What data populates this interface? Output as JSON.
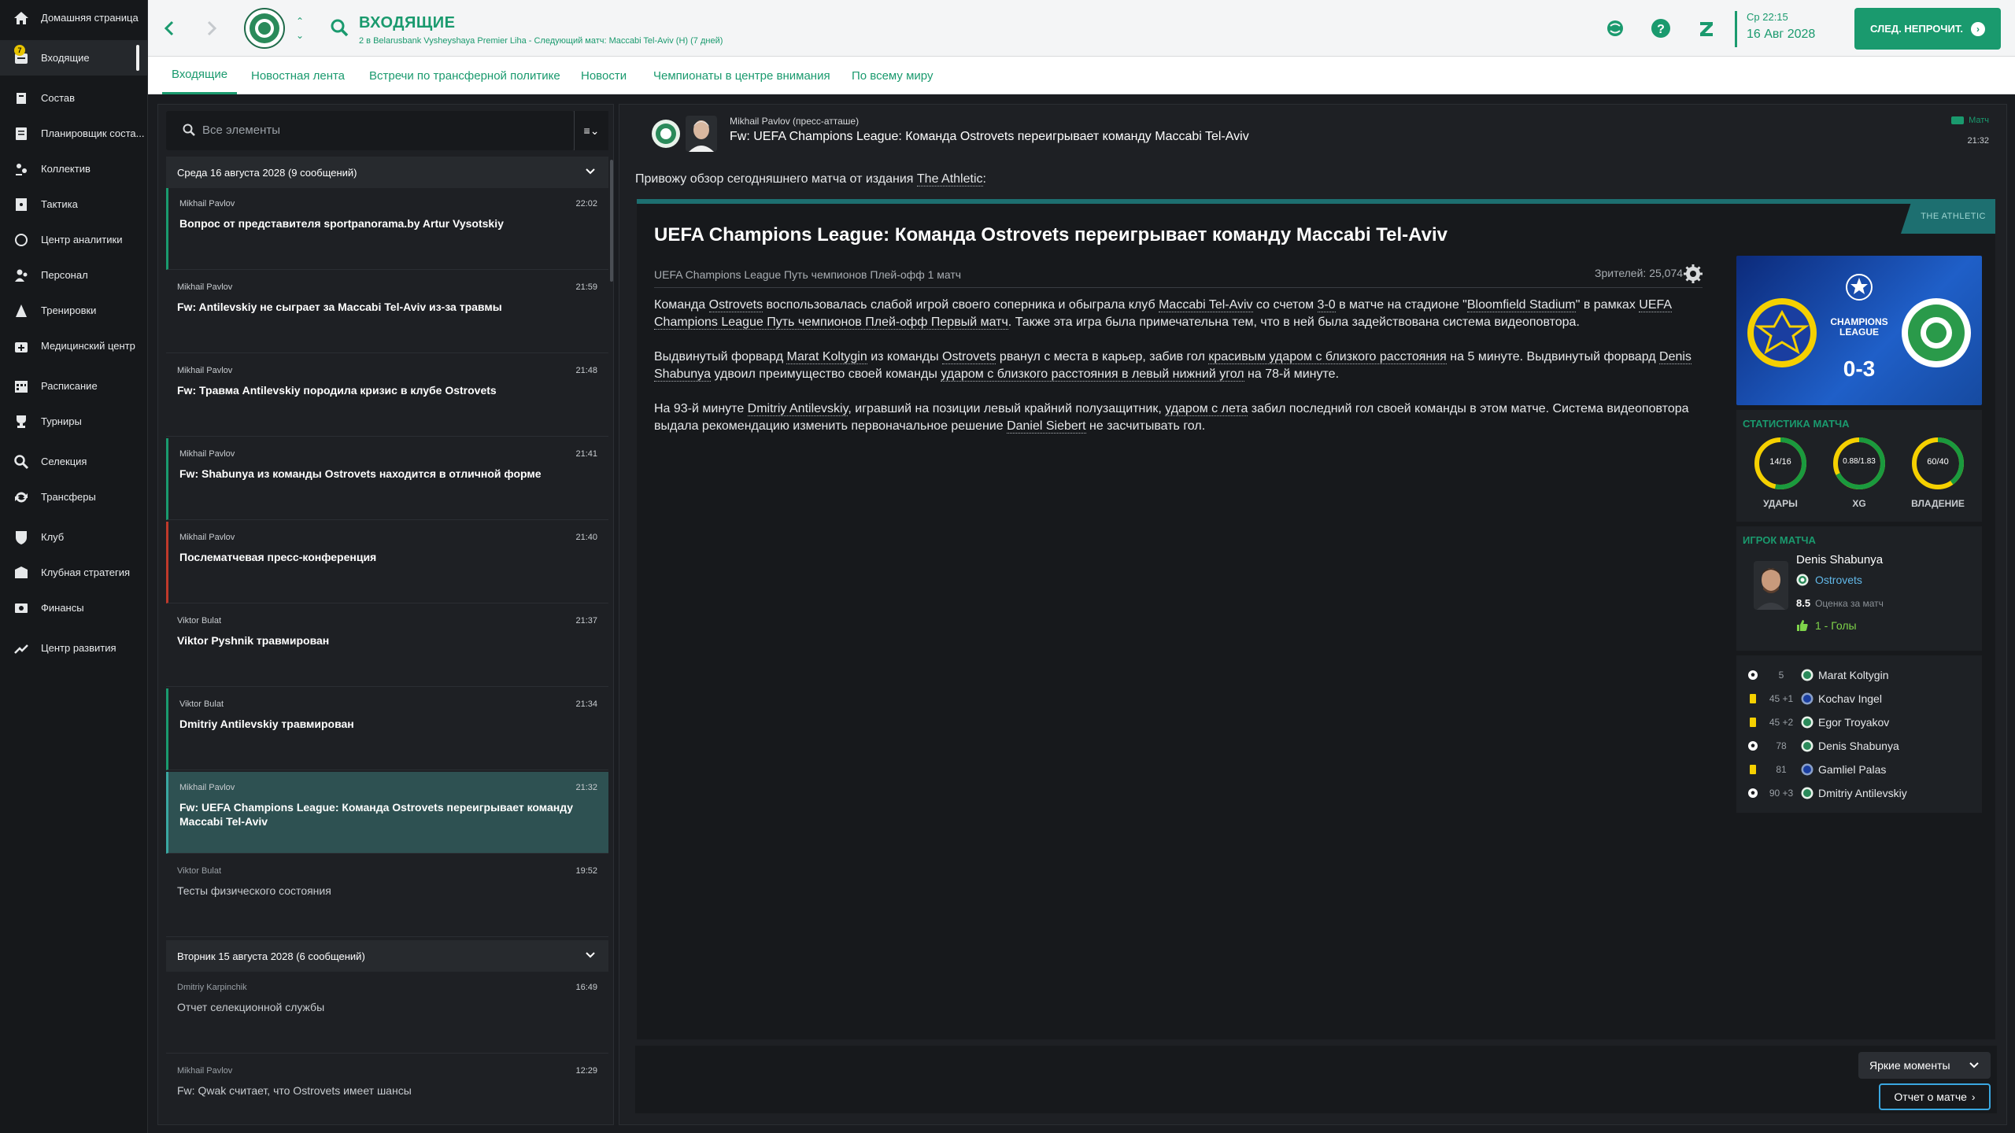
{
  "sidebar": {
    "items": [
      {
        "label": "Домашняя страница",
        "icon": "home-icon"
      },
      {
        "label": "Входящие",
        "icon": "inbox-icon",
        "badge": "7"
      },
      {
        "label": "Состав",
        "icon": "squad-icon"
      },
      {
        "label": "Планировщик соста...",
        "icon": "planner-icon"
      },
      {
        "label": "Коллектив",
        "icon": "dynamics-icon"
      },
      {
        "label": "Тактика",
        "icon": "tactics-icon"
      },
      {
        "label": "Центр аналитики",
        "icon": "analytics-icon"
      },
      {
        "label": "Персонал",
        "icon": "staff-icon"
      },
      {
        "label": "Тренировки",
        "icon": "training-icon"
      },
      {
        "label": "Медицинский центр",
        "icon": "medical-icon"
      },
      {
        "label": "Расписание",
        "icon": "calendar-icon"
      },
      {
        "label": "Турниры",
        "icon": "trophy-icon"
      },
      {
        "label": "Селекция",
        "icon": "scouting-icon"
      },
      {
        "label": "Трансферы",
        "icon": "transfers-icon"
      },
      {
        "label": "Клуб",
        "icon": "club-icon"
      },
      {
        "label": "Клубная стратегия",
        "icon": "strategy-icon"
      },
      {
        "label": "Финансы",
        "icon": "finance-icon"
      },
      {
        "label": "Центр развития",
        "icon": "development-icon"
      }
    ]
  },
  "header": {
    "title": "ВХОДЯЩИЕ",
    "subtitle": "2 в Belarusbank Vysheyshaya Premier Liha - Следующий матч: Maccabi Tel-Aviv (H) (7 дней)",
    "date_day": "Ср 22:15",
    "date_full": "16 Авг 2028",
    "next_button": "СЛЕД. НЕПРОЧИТ.",
    "accent": "#1a9a6e"
  },
  "tabs": [
    "Входящие",
    "Новостная лента",
    "Встречи по трансферной политике",
    "Новости",
    "Чемпионаты в центре внимания",
    "По всему миру"
  ],
  "inbox": {
    "search_placeholder": "Все элементы",
    "groups": [
      {
        "label": "Среда 16 августа 2028 (9 сообщений)"
      },
      {
        "label": "Вторник 15 августа 2028 (6 сообщений)"
      }
    ],
    "messages": [
      {
        "from": "Mikhail Pavlov",
        "time": "22:02",
        "subject": "Вопрос от представителя sportpanorama.by Artur Vysotskiy"
      },
      {
        "from": "Mikhail Pavlov",
        "time": "21:59",
        "subject": "Fw: Antilevskiy не сыграет за Maccabi Tel-Aviv из-за травмы"
      },
      {
        "from": "Mikhail Pavlov",
        "time": "21:48",
        "subject": "Fw: Травма Antilevskiy породила кризис в клубе Ostrovets"
      },
      {
        "from": "Mikhail Pavlov",
        "time": "21:41",
        "subject": "Fw: Shabunya из команды Ostrovets находится в отличной форме"
      },
      {
        "from": "Mikhail Pavlov",
        "time": "21:40",
        "subject": "Послематчевая пресс-конференция"
      },
      {
        "from": "Viktor Bulat",
        "time": "21:37",
        "subject": "Viktor Pyshnik травмирован"
      },
      {
        "from": "Viktor Bulat",
        "time": "21:34",
        "subject": "Dmitriy Antilevskiy травмирован"
      },
      {
        "from": "Mikhail Pavlov",
        "time": "21:32",
        "subject": "Fw: UEFA Champions League: Команда Ostrovets переигрывает команду Maccabi Tel-Aviv"
      },
      {
        "from": "Viktor Bulat",
        "time": "19:52",
        "subject": "Тесты физического состояния"
      },
      {
        "from": "Dmitriy Karpinchik",
        "time": "16:49",
        "subject": "Отчет селекционной службы"
      },
      {
        "from": "Mikhail Pavlov",
        "time": "12:29",
        "subject": "Fw: Qwak считает, что Ostrovets имеет шансы"
      }
    ]
  },
  "detail": {
    "from": "Mikhail Pavlov  (пресс-атташе)",
    "subject": "Fw: UEFA Champions League: Команда Ostrovets переигрывает команду Maccabi Tel-Aviv",
    "tag": "Матч",
    "time": "21:32",
    "intro_prefix": "Привожу обзор сегодняшнего матча от издания ",
    "intro_source": "The Athletic",
    "intro_suffix": ":",
    "article": {
      "corner": "THE ATHLETIC",
      "title": "UEFA Champions League: Команда Ostrovets переигрывает команду Maccabi Tel-Aviv",
      "competition": "UEFA Champions League Путь чемпионов Плей-офф 1 матч",
      "attendance": "Зрителей: 25,074",
      "p1": [
        "Команда ",
        {
          "u": "Ostrovets"
        },
        " воспользовалась слабой игрой своего соперника и обыграла клуб ",
        {
          "u": "Maccabi Tel-Aviv"
        },
        " со счетом ",
        {
          "u": "3-0"
        },
        " в матче на стадионе \"",
        {
          "u": "Bloomfield Stadium"
        },
        "\" в рамках ",
        {
          "u": "UEFA Champions League Путь чемпионов Плей-офф Первый матч"
        },
        ". Также эта игра была примечательна тем, что в ней была задействована система видеоповтора."
      ],
      "p2": [
        "Выдвинутый форвард ",
        {
          "u": "Marat Koltygin"
        },
        " из команды ",
        {
          "u": "Ostrovets"
        },
        " рванул с места в карьер, забив гол ",
        {
          "u": "красивым ударом с близкого расстояния"
        },
        " на 5 минуте. Выдвинутый форвард ",
        {
          "u": "Denis Shabunya"
        },
        " удвоил преимущество своей команды ",
        {
          "u": "ударом с близкого расстояния в левый нижний угол"
        },
        " на 78-й минуте."
      ],
      "p3": [
        "На 93-й минуте ",
        {
          "u": "Dmitriy Antilevskiy"
        },
        ", игравший на позиции левый крайний полузащитник, ",
        {
          "u": "ударом с лета"
        },
        " забил последний гол своей команды в этом матче. Система видеоповтора выдала рекомендацию изменить первоначальное решение ",
        {
          "u": "Daniel Siebert"
        },
        " не засчитывать гол."
      ]
    },
    "scorecard": {
      "competition_line1": "CHAMPIONS",
      "competition_line2": "LEAGUE",
      "score": "0-3"
    },
    "stats": {
      "title": "СТАТИСТИКА МАТЧА",
      "items": [
        {
          "value": "14/16",
          "label": "УДАРЫ",
          "home": 14,
          "away": 16
        },
        {
          "value": "0.88/1.83",
          "label": "XG",
          "home": 0.88,
          "away": 1.83
        },
        {
          "value": "60/40",
          "label": "ВЛАДЕНИЕ",
          "home": 60,
          "away": 40
        }
      ]
    },
    "potm": {
      "title": "ИГРОК МАТЧА",
      "name": "Denis Shabunya",
      "club": "Ostrovets",
      "rating": "8.5",
      "rating_label": "Оценка за матч",
      "goals": "1 - Голы"
    },
    "events": [
      {
        "type": "goal",
        "minute": "5",
        "player": "Marat Koltygin",
        "team": "ostrovets"
      },
      {
        "type": "yellow",
        "minute": "45 +1",
        "player": "Kochav Ingel",
        "team": "maccabi"
      },
      {
        "type": "yellow",
        "minute": "45 +2",
        "player": "Egor Troyakov",
        "team": "ostrovets"
      },
      {
        "type": "goal",
        "minute": "78",
        "player": "Denis Shabunya",
        "team": "ostrovets"
      },
      {
        "type": "yellow",
        "minute": "81",
        "player": "Gamliel Palas",
        "team": "maccabi"
      },
      {
        "type": "goal",
        "minute": "90 +3",
        "player": "Dmitriy Antilevskiy",
        "team": "ostrovets"
      }
    ],
    "highlights_button": "Яркие моменты",
    "report_button": "Отчет о матче"
  }
}
